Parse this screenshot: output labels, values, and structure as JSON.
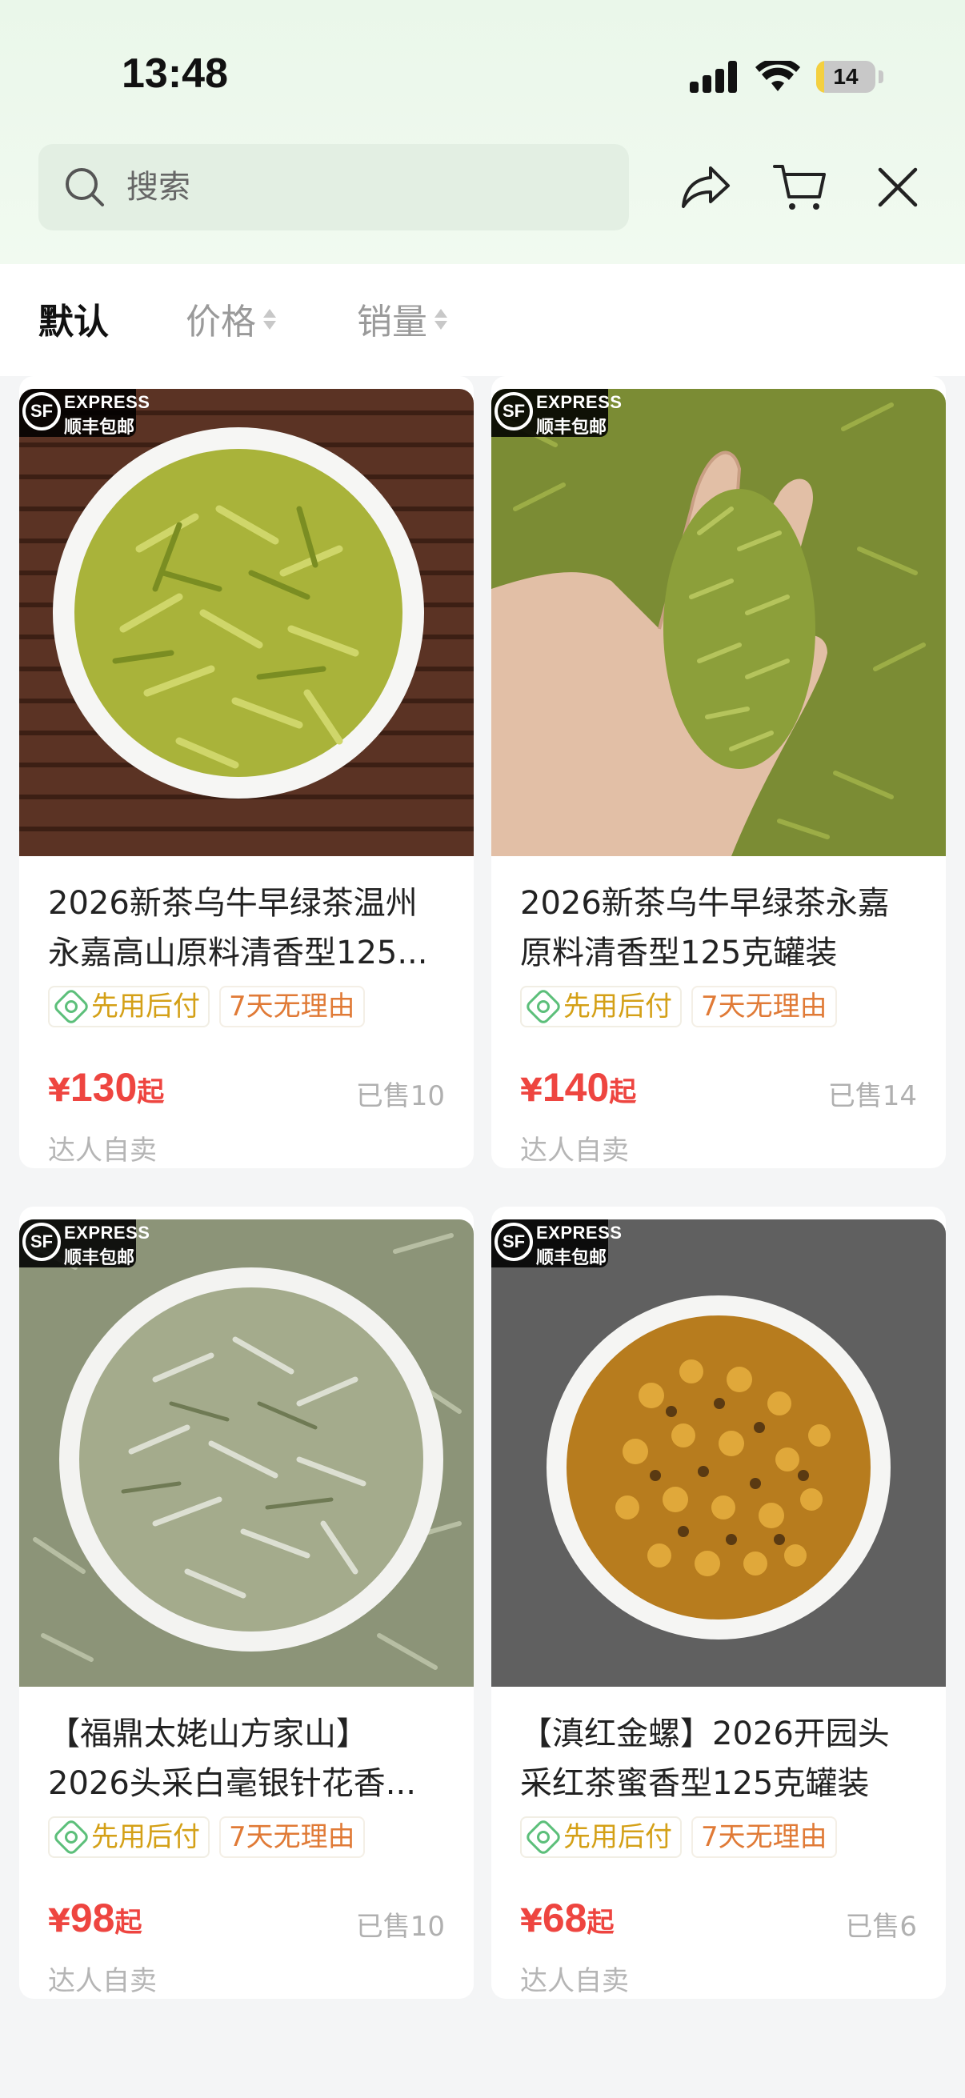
{
  "status_bar": {
    "time": "13:48",
    "battery": "14",
    "battery_level": 0.14
  },
  "header": {
    "search_placeholder": "搜索",
    "icons": [
      "search-icon",
      "share-icon",
      "cart-icon",
      "close-icon"
    ]
  },
  "sort_tabs": [
    {
      "label": "默认",
      "active": true
    },
    {
      "label": "价格",
      "active": false
    },
    {
      "label": "销量",
      "active": false
    }
  ],
  "badge": {
    "express": "EXPRESS",
    "free_shipping": "顺丰包邮",
    "logo": "SF"
  },
  "products": [
    {
      "title_line1": "2026新茶乌牛早绿茶温州",
      "title_line2": "永嘉高山原料清香型125...",
      "tag_pay": "先用后付",
      "tag_return": "7天无理由",
      "price_symbol": "¥",
      "price": "130",
      "price_suffix": "起",
      "sold": "已售10",
      "seller": "达人自卖",
      "image": "green-tea-plate"
    },
    {
      "title_line1": "2026新茶乌牛早绿茶永嘉",
      "title_line2": "原料清香型125克罐装",
      "tag_pay": "先用后付",
      "tag_return": "7天无理由",
      "price_symbol": "¥",
      "price": "140",
      "price_suffix": "起",
      "sold": "已售14",
      "seller": "达人自卖",
      "image": "green-tea-hand"
    },
    {
      "title_line1": "【福鼎太姥山方家山】",
      "title_line2": "2026头采白毫银针花香...",
      "tag_pay": "先用后付",
      "tag_return": "7天无理由",
      "price_symbol": "¥",
      "price": "98",
      "price_suffix": "起",
      "sold": "已售10",
      "seller": "达人自卖",
      "image": "white-tea-plate"
    },
    {
      "title_line1": "【滇红金螺】2026开园头",
      "title_line2": "采红茶蜜香型125克罐装",
      "tag_pay": "先用后付",
      "tag_return": "7天无理由",
      "price_symbol": "¥",
      "price": "68",
      "price_suffix": "起",
      "sold": "已售6",
      "seller": "达人自卖",
      "image": "black-tea-plate"
    }
  ],
  "colors": {
    "price": "#ee4540",
    "header_bg": "#eaf7ea",
    "pay_tag": "#d4a017",
    "return_tag": "#e07a36"
  }
}
